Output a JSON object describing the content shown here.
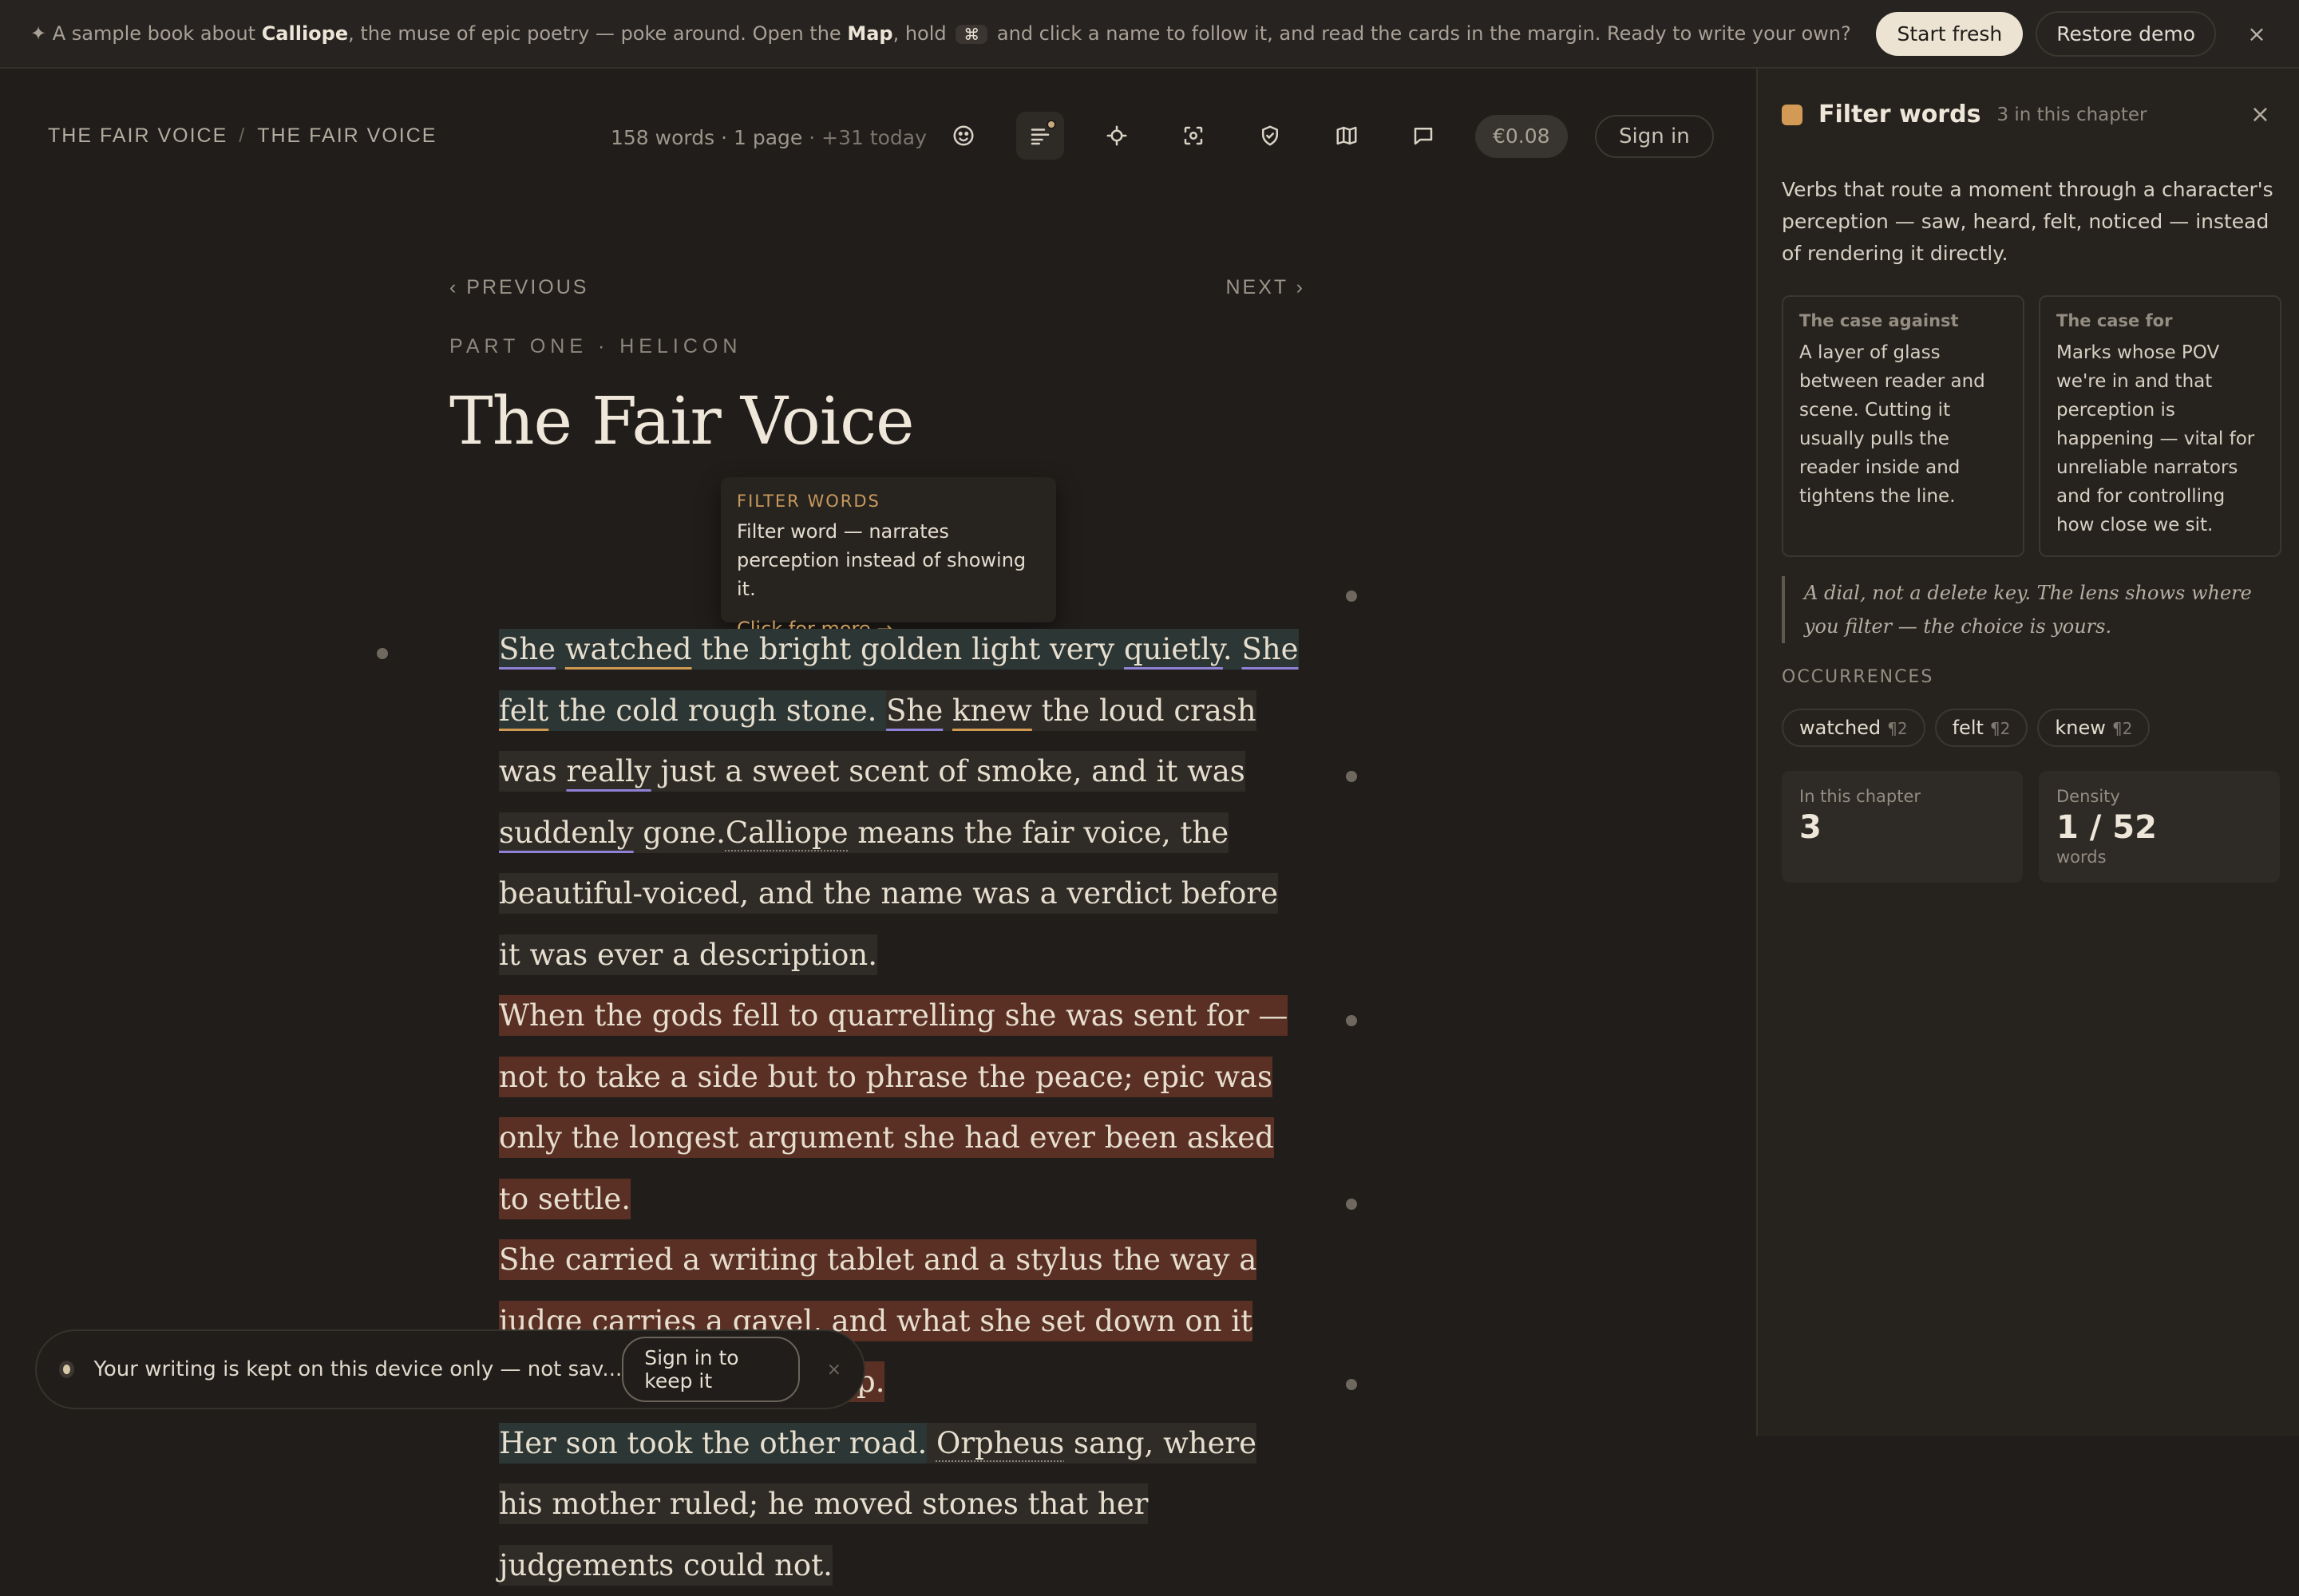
{
  "banner": {
    "sparkle": "✦",
    "t1": "A sample book about ",
    "b1": "Calliope",
    "t2": ", the muse of epic poetry — poke around. Open the ",
    "b2": "Map",
    "t3": ", hold ",
    "kbd": "⌘",
    "t4": " and click a name to follow it, and read the cards in the margin. Ready to write your own?",
    "start_label": "Start fresh",
    "restore_label": "Restore demo",
    "close": "×"
  },
  "breadcrumb": {
    "book": "THE FAIR VOICE",
    "sep": "/",
    "chapter": "THE FAIR VOICE"
  },
  "stats": {
    "words": "158 words · 1 page",
    "dot": " · ",
    "today": "+31 today"
  },
  "toolbar": {
    "icons": [
      "palette-icon",
      "lines-icon",
      "target-icon",
      "focus-icon",
      "shield-icon",
      "map-icon",
      "comment-icon"
    ],
    "price": "€0.08",
    "signin": "Sign in"
  },
  "pager": {
    "prev": "‹ PREVIOUS",
    "next": "NEXT ›"
  },
  "chapter": {
    "part": "PART ONE · HELICON",
    "title": "The Fair Voice"
  },
  "tooltip": {
    "kicker": "FILTER WORDS",
    "body": "Filter word — narrates perception instead of showing it.",
    "more": "Click for more →"
  },
  "prose": {
    "p1": [
      "She",
      " ",
      "watched",
      " the bright golden light very ",
      "quietly",
      ". ",
      "She",
      " ",
      "felt",
      " the cold rough stone. ",
      "She",
      " ",
      "knew",
      " the loud crash was ",
      "really",
      " just a sweet scent of smoke, and it was ",
      "suddenly",
      " gone.",
      "Calliope",
      " means the fair voice, the beautiful-voiced, and the name was a verdict before it was ever a description."
    ],
    "p2": "When the gods fell to quarrelling she was sent for — not to take a side but to phrase the peace; epic was only the longest argument she had ever been asked to settle.",
    "p3": "She carried a writing tablet and a stylus the way a judge carries a gavel, and what she set down on it the world tended to keep.",
    "p4": [
      "Her son took the other road.",
      " ",
      "Orpheus",
      " sang, where his mother ruled; he moved stones that her judgements could not."
    ]
  },
  "toast": {
    "text": "Your writing is kept on this device only — not sav...",
    "button": "Sign in to keep it",
    "close": "×"
  },
  "panel": {
    "swatch_color": "#d39a55",
    "title": "Filter words",
    "count": "3 in this chapter",
    "close": "×",
    "description": "Verbs that route a moment through a character's perception — saw, heard, felt, noticed — instead of rendering it directly.",
    "case_against": {
      "title": "The case against",
      "body": "A layer of glass between reader and scene. Cutting it usually pulls the reader inside and tightens the line."
    },
    "case_for": {
      "title": "The case for",
      "body": "Marks whose POV we're in and that perception is happening — vital for unreliable narrators and for controlling how close we sit."
    },
    "quote": "A dial, not a delete key. The lens shows where you filter — the choice is yours.",
    "occurrences_label": "OCCURRENCES",
    "occurrences": [
      {
        "word": "watched",
        "para": "¶2"
      },
      {
        "word": "felt",
        "para": "¶2"
      },
      {
        "word": "knew",
        "para": "¶2"
      }
    ],
    "in_chapter": {
      "label": "In this chapter",
      "value": "3"
    },
    "density": {
      "label": "Density",
      "value": "1 / 52",
      "unit": "words"
    }
  }
}
